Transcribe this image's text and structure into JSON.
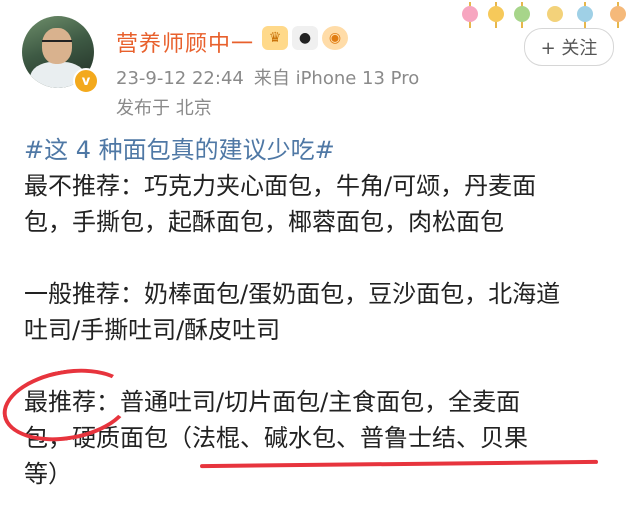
{
  "post": {
    "author_name": "营养师顾中一",
    "verified_badge": "v",
    "timestamp": "23-9-12 22:44",
    "source": "来自 iPhone 13 Pro",
    "location": "发布于 北京",
    "follow_label": "+ 关注"
  },
  "badges": [
    "crown-badge-icon",
    "panda-badge-icon",
    "fish-badge-icon"
  ],
  "colors": {
    "name": "#e8602c",
    "hashtag": "#4f78a5",
    "annotation": "#e7343d",
    "meta": "#8a8a8a"
  },
  "content": {
    "hashtag": "#这 4 种面包真的建议少吃#",
    "section1": {
      "line1": "最不推荐：巧克力夹心面包，牛角/可颂，丹麦面",
      "line2": "包，手撕包，起酥面包，椰蓉面包，肉松面包"
    },
    "section2": {
      "line1": "一般推荐：奶棒面包/蛋奶面包，豆沙面包，北海道",
      "line2": "吐司/手撕吐司/酥皮吐司"
    },
    "section3": {
      "line1": "最推荐：普通吐司/切片面包/主食面包，全麦面",
      "line2": "包，硬质面包（法棍、碱水包、普鲁士结、贝果",
      "line3": "等）"
    }
  }
}
